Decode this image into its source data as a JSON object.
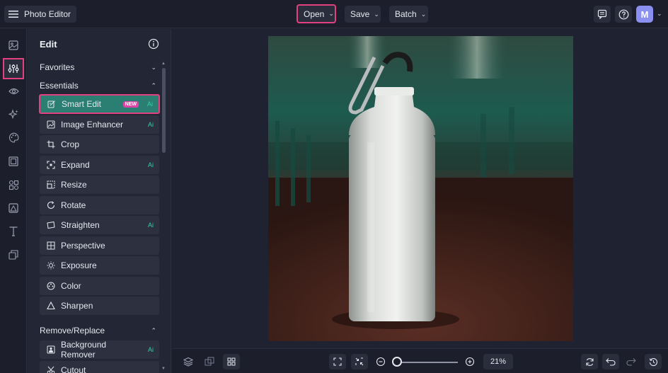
{
  "header": {
    "app_title": "Photo Editor",
    "menus": [
      {
        "label": "Open"
      },
      {
        "label": "Save"
      },
      {
        "label": "Batch"
      }
    ],
    "avatar_initial": "M"
  },
  "rail": {
    "items": [
      "image-icon",
      "adjust-sliders-icon",
      "eye-icon",
      "sparkle-effects-icon",
      "palette-icon",
      "frame-icon",
      "graphics-icon",
      "overlay-icon",
      "text-icon",
      "layers-stack-icon"
    ],
    "active": "adjust-sliders-icon"
  },
  "panel": {
    "title": "Edit",
    "sections": {
      "favorites": "Favorites",
      "essentials": "Essentials",
      "remove_replace": "Remove/Replace"
    },
    "tools": [
      {
        "label": "Smart Edit",
        "badge": "NEW",
        "ai": "Ai"
      },
      {
        "label": "Image Enhancer",
        "ai": "Ai"
      },
      {
        "label": "Crop"
      },
      {
        "label": "Expand",
        "ai": "Ai"
      },
      {
        "label": "Resize"
      },
      {
        "label": "Rotate"
      },
      {
        "label": "Straighten",
        "ai": "Ai"
      },
      {
        "label": "Perspective"
      },
      {
        "label": "Exposure"
      },
      {
        "label": "Color"
      },
      {
        "label": "Sharpen"
      }
    ],
    "remove_tools": [
      {
        "label": "Background Remover",
        "ai": "Ai"
      },
      {
        "label": "Cutout"
      }
    ]
  },
  "canvas": {
    "image_subject": "white aluminum water bottle with carabiner"
  },
  "bottom": {
    "zoom": "21%",
    "zoom_level_fraction": 0.0
  },
  "colors": {
    "accent_highlight": "#e2407f",
    "selected_tool": "#2a7f72",
    "ai_label": "#33d0a6",
    "new_badge": "#d946a8",
    "avatar": "#8a8ff0"
  }
}
